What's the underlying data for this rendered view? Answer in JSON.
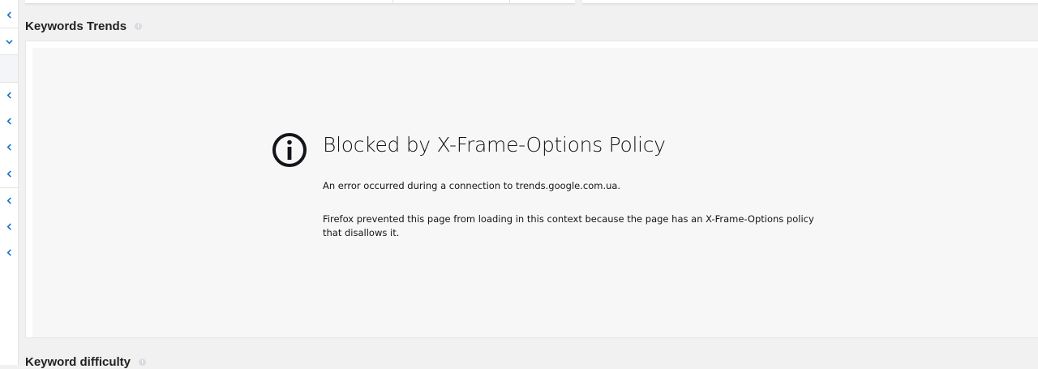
{
  "sidebar": {
    "icons": [
      "chevron-left-icon",
      "chevron-down-icon",
      "chevron-left-icon",
      "chevron-left-icon",
      "chevron-left-icon",
      "chevron-left-icon",
      "chevron-left-icon",
      "chevron-left-icon",
      "chevron-left-icon"
    ],
    "accent_color": "#1a73c8"
  },
  "keywords_trends": {
    "title": "Keywords Trends",
    "info_icon": "info-icon"
  },
  "blocked_frame": {
    "icon": "info-circle-icon",
    "title": "Blocked by X-Frame-Options Policy",
    "message": "An error occurred during a connection to trends.google.com.ua.",
    "detail": "Firefox prevented this page from loading in this context because the page has an X-Frame-Options policy that disallows it."
  },
  "keyword_difficulty": {
    "title": "Keyword difficulty",
    "info_icon": "info-icon"
  }
}
